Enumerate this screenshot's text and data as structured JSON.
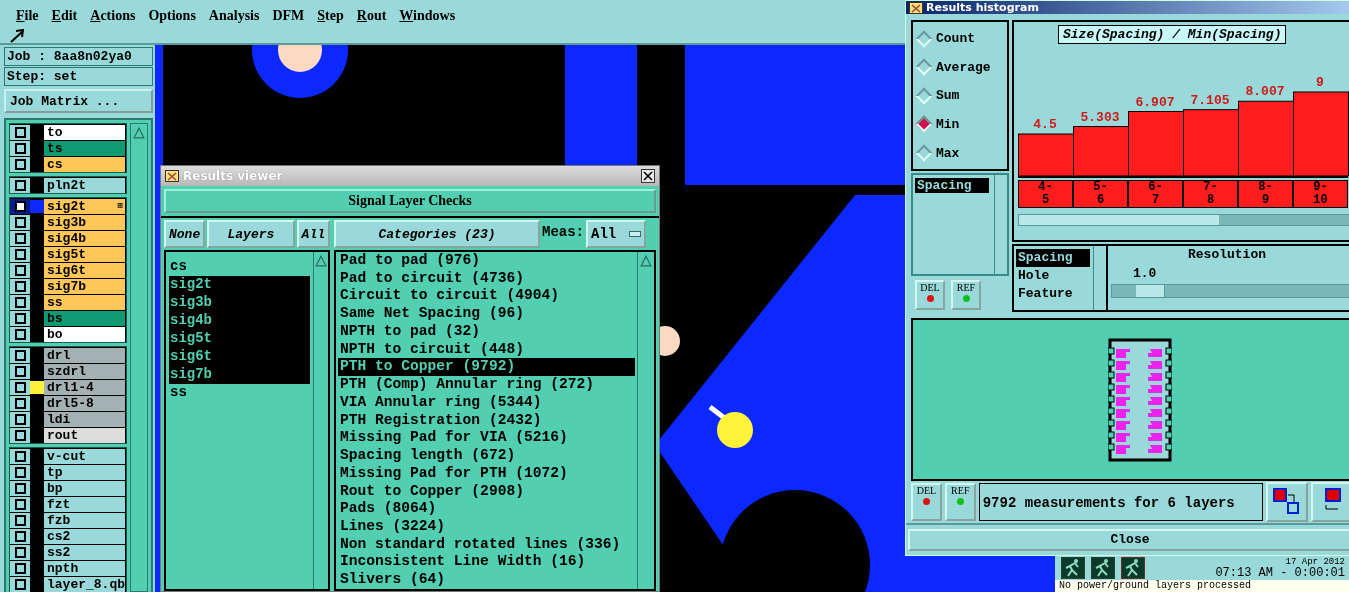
{
  "menu": [
    {
      "label": "File",
      "mnemonic": true
    },
    {
      "label": "Edit",
      "mnemonic": true
    },
    {
      "label": "Actions",
      "mnemonic": true
    },
    {
      "label": "Options",
      "mnemonic": false
    },
    {
      "label": "Analysis",
      "mnemonic": false
    },
    {
      "label": "DFM",
      "mnemonic": false
    },
    {
      "label": "Step",
      "mnemonic": true
    },
    {
      "label": "Rout",
      "mnemonic": true
    },
    {
      "label": "Windows",
      "mnemonic": true
    }
  ],
  "job": {
    "label": "Job : 8aa8n02ya0",
    "step": "Step: set",
    "matrix_button": "Job Matrix ..."
  },
  "layer_groups": [
    {
      "layers": [
        {
          "name": "to",
          "color": "#ffffff",
          "selected": false
        },
        {
          "name": "ts",
          "color": "#0f9a72",
          "selected": false
        },
        {
          "name": "cs",
          "color": "#ffc65a",
          "selected": false
        }
      ]
    },
    {
      "layers": [
        {
          "name": "pln2t",
          "color": "#99d9d9",
          "selected": false
        }
      ]
    },
    {
      "layers": [
        {
          "name": "sig2t",
          "color": "#ffc65a",
          "selected": true,
          "swatch": {
            "color": "#0a28ff"
          },
          "badge": "⊞"
        },
        {
          "name": "sig3b",
          "color": "#ffc65a",
          "selected": false
        },
        {
          "name": "sig4b",
          "color": "#ffc65a",
          "selected": false
        },
        {
          "name": "sig5t",
          "color": "#ffc65a",
          "selected": false
        },
        {
          "name": "sig6t",
          "color": "#ffc65a",
          "selected": false
        },
        {
          "name": "sig7b",
          "color": "#ffc65a",
          "selected": false
        },
        {
          "name": "ss",
          "color": "#ffc65a",
          "selected": false
        },
        {
          "name": "bs",
          "color": "#0f9a72",
          "selected": false
        },
        {
          "name": "bo",
          "color": "#ffffff",
          "selected": false
        }
      ]
    },
    {
      "layers": [
        {
          "name": "drl",
          "color": "#a3b1b3",
          "selected": false
        },
        {
          "name": "szdrl",
          "color": "#a3b1b3",
          "selected": false
        },
        {
          "name": "drl1-4",
          "color": "#a3b1b3",
          "selected": false,
          "swatch": {
            "color": "#fff03a"
          }
        },
        {
          "name": "drl5-8",
          "color": "#a3b1b3",
          "selected": false
        },
        {
          "name": "ldi",
          "color": "#a3b1b3",
          "selected": false
        },
        {
          "name": "rout",
          "color": "#dcdcdc",
          "selected": false
        }
      ]
    },
    {
      "layers": [
        {
          "name": "v-cut",
          "color": "#99d9d9",
          "selected": false
        },
        {
          "name": "tp",
          "color": "#99d9d9",
          "selected": false
        },
        {
          "name": "bp",
          "color": "#99d9d9",
          "selected": false
        },
        {
          "name": "fzt",
          "color": "#99d9d9",
          "selected": false
        },
        {
          "name": "fzb",
          "color": "#99d9d9",
          "selected": false
        },
        {
          "name": "cs2",
          "color": "#99d9d9",
          "selected": false
        },
        {
          "name": "ss2",
          "color": "#99d9d9",
          "selected": false
        },
        {
          "name": "npth",
          "color": "#99d9d9",
          "selected": false
        },
        {
          "name": "layer_8.qb",
          "color": "#99d9d9",
          "selected": false
        }
      ]
    }
  ],
  "results_viewer": {
    "title": "Results viewer",
    "header": "Signal Layer Checks",
    "none_button": "None",
    "layers_button": "Layers",
    "all_button": "All",
    "categories_button": "Categories (23)",
    "meas_label": "Meas:",
    "meas_value": "All",
    "layers": [
      {
        "name": "cs",
        "selected": false
      },
      {
        "name": "sig2t",
        "selected": true
      },
      {
        "name": "sig3b",
        "selected": true
      },
      {
        "name": "sig4b",
        "selected": true
      },
      {
        "name": "sig5t",
        "selected": true
      },
      {
        "name": "sig6t",
        "selected": true
      },
      {
        "name": "sig7b",
        "selected": true
      },
      {
        "name": "ss",
        "selected": false
      }
    ],
    "categories": [
      {
        "name": "Pad to pad (976)",
        "selected": false
      },
      {
        "name": "Pad to circuit (4736)",
        "selected": false
      },
      {
        "name": "Circuit to circuit (4904)",
        "selected": false
      },
      {
        "name": "Same Net Spacing (96)",
        "selected": false
      },
      {
        "name": "NPTH to pad (32)",
        "selected": false
      },
      {
        "name": "NPTH to circuit (448)",
        "selected": false
      },
      {
        "name": "PTH to Copper (9792)",
        "selected": true
      },
      {
        "name": "PTH (Comp) Annular ring (272)",
        "selected": false
      },
      {
        "name": "VIA Annular ring (5344)",
        "selected": false
      },
      {
        "name": "PTH Registration (2432)",
        "selected": false
      },
      {
        "name": "Missing Pad for VIA (5216)",
        "selected": false
      },
      {
        "name": "Spacing length (672)",
        "selected": false
      },
      {
        "name": "Missing Pad for PTH (1072)",
        "selected": false
      },
      {
        "name": "Rout to Copper (2908)",
        "selected": false
      },
      {
        "name": "Pads (8064)",
        "selected": false
      },
      {
        "name": "Lines (3224)",
        "selected": false
      },
      {
        "name": "Non standard rotated lines (336)",
        "selected": false
      },
      {
        "name": "Inconsistent Line Width (16)",
        "selected": false
      },
      {
        "name": "Slivers (64)",
        "selected": false
      }
    ]
  },
  "histogram": {
    "title": "Results histogram",
    "modes": [
      {
        "label": "Count",
        "selected": false
      },
      {
        "label": "Average",
        "selected": false
      },
      {
        "label": "Sum",
        "selected": false
      },
      {
        "label": "Min",
        "selected": true
      },
      {
        "label": "Max",
        "selected": false
      }
    ],
    "measures": [
      {
        "label": "Spacing",
        "selected": true
      }
    ],
    "del_button": "DEL",
    "ref_button": "REF",
    "chart_data": {
      "type": "bar",
      "title": "Size(Spacing) / Min(Spacing)",
      "categories": [
        "4-5",
        "5-6",
        "6-7",
        "7-8",
        "8-9",
        "9-10"
      ],
      "values": [
        4.5,
        5.303,
        6.907,
        7.105,
        8.007,
        9
      ],
      "data_labels": true
    },
    "sizes": [
      {
        "label": "Spacing",
        "selected": true
      },
      {
        "label": "Hole",
        "selected": false
      },
      {
        "label": "Feature",
        "selected": false
      }
    ],
    "resolution_label": "Resolution",
    "resolution_value": "1.0",
    "resolution_slider": {
      "level": 0.1
    },
    "status_del": "DEL",
    "status_ref": "REF",
    "status": "9792 measurements for 6 layers",
    "close_button": "Close"
  },
  "status_panel": {
    "date": "17 Apr 2012",
    "time": "07:13 AM - 0:00:01",
    "message": "No power/ground layers processed"
  }
}
